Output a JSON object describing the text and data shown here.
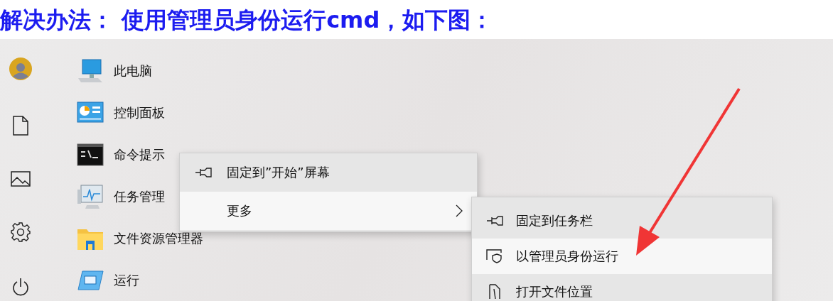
{
  "heading": "解决办法： 使用管理员身份运行cmd，如下图：",
  "apps": [
    {
      "kind": "computer",
      "label": "此电脑"
    },
    {
      "kind": "control-panel",
      "label": "控制面板"
    },
    {
      "kind": "terminal",
      "label": "命令提示"
    },
    {
      "kind": "monitor",
      "label": "任务管理"
    },
    {
      "kind": "folder",
      "label": "文件资源管理器"
    },
    {
      "kind": "run",
      "label": "运行"
    }
  ],
  "context_menu": {
    "items": [
      {
        "kind": "pin",
        "label": "固定到”开始”屏幕",
        "selected": false
      },
      {
        "kind": "more",
        "label": "更多",
        "selected": true
      }
    ]
  },
  "submenu": {
    "items": [
      {
        "kind": "pin",
        "label": "固定到任务栏",
        "selected": false
      },
      {
        "kind": "admin",
        "label": "以管理员身份运行",
        "selected": true
      },
      {
        "kind": "location",
        "label": "打开文件位置",
        "selected": false
      }
    ]
  }
}
